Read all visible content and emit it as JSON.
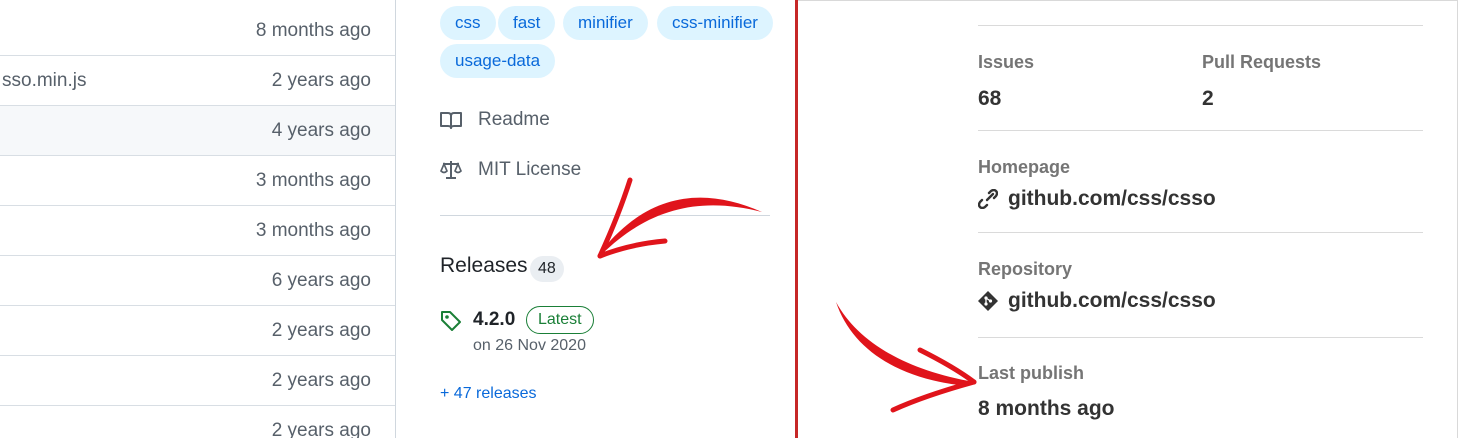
{
  "file_list": {
    "rows": [
      {
        "name": "",
        "time": "8 months ago"
      },
      {
        "name": "sso.min.js",
        "time": "2 years ago"
      },
      {
        "name": "",
        "time": "4 years ago"
      },
      {
        "name": "",
        "time": "3 months ago"
      },
      {
        "name": "",
        "time": "3 months ago"
      },
      {
        "name": "",
        "time": "6 years ago"
      },
      {
        "name": "",
        "time": "2 years ago"
      },
      {
        "name": "",
        "time": "2 years ago"
      },
      {
        "name": "",
        "time": "2 years ago"
      }
    ]
  },
  "sidebar": {
    "topics": [
      "css",
      "fast",
      "minifier",
      "css-minifier",
      "usage-data"
    ],
    "readme_label": "Readme",
    "license_label": "MIT License",
    "releases": {
      "title": "Releases",
      "count": "48",
      "latest_version": "4.2.0",
      "latest_badge": "Latest",
      "latest_date": "on 26 Nov 2020",
      "more_link": "+ 47 releases"
    }
  },
  "npm": {
    "issues_label": "Issues",
    "issues_value": "68",
    "pull_requests_label": "Pull Requests",
    "pull_requests_value": "2",
    "homepage_label": "Homepage",
    "homepage_value": "github.com/css/csso",
    "repository_label": "Repository",
    "repository_value": "github.com/css/csso",
    "last_publish_label": "Last publish",
    "last_publish_value": "8 months ago"
  },
  "colors": {
    "annotation": "#e0141b",
    "separator": "#c62828",
    "link": "#0969da",
    "latest_green": "#1a7f37"
  },
  "icons": [
    "book-icon",
    "law-icon",
    "tag-icon",
    "link-icon",
    "git-icon"
  ]
}
